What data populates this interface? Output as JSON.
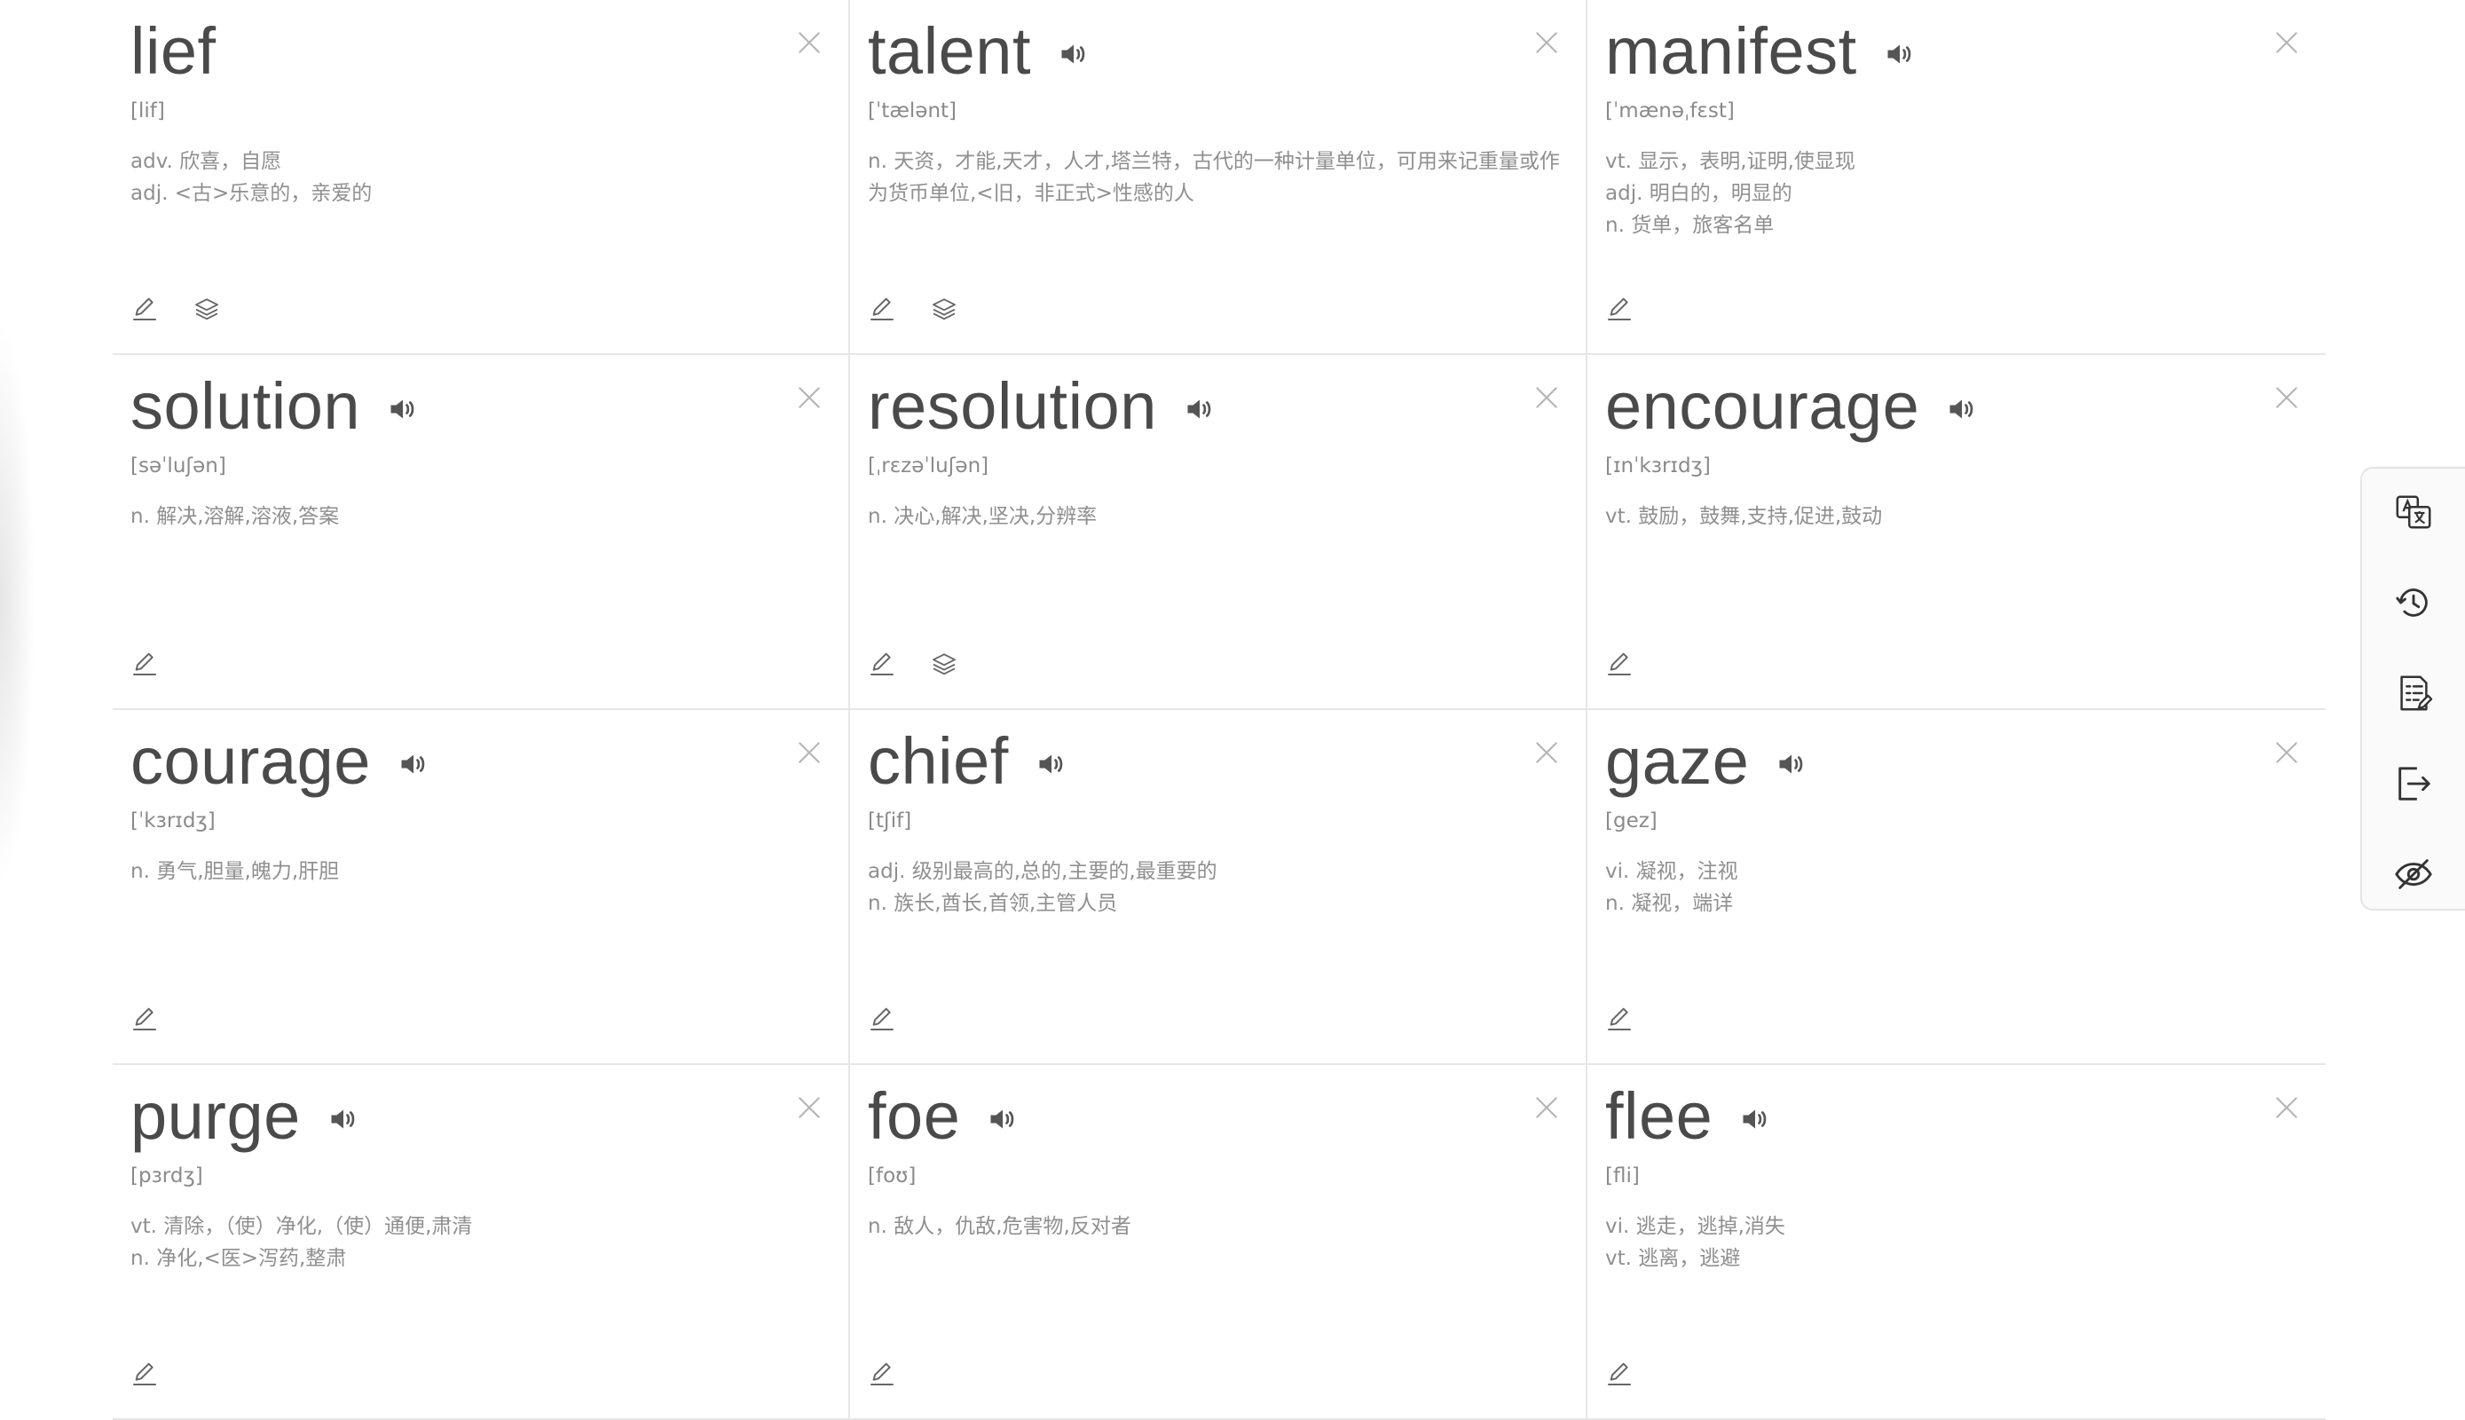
{
  "cards": [
    {
      "word": "lief",
      "speaker": false,
      "phonetic": "[lif]",
      "defs": [
        "adv. 欣喜，自愿",
        "adj. <古>乐意的，亲爱的"
      ],
      "actions": [
        "edit-icon",
        "layers-icon"
      ]
    },
    {
      "word": "talent",
      "speaker": true,
      "phonetic": "[ˈtælənt]",
      "defs": [
        "n. 天资，才能,天才，人才,塔兰特，古代的一种计量单位，可用来记重量或作为货币单位,<旧，非正式>性感的人"
      ],
      "actions": [
        "edit-icon",
        "layers-icon"
      ]
    },
    {
      "word": "manifest",
      "speaker": true,
      "phonetic": "[ˈmænəˌfɛst]",
      "defs": [
        "vt. 显示，表明,证明,使显现",
        "adj. 明白的，明显的",
        "n. 货单，旅客名单"
      ],
      "actions": [
        "edit-icon"
      ]
    },
    {
      "word": "solution",
      "speaker": true,
      "phonetic": "[səˈluʃən]",
      "defs": [
        "n. 解决,溶解,溶液,答案"
      ],
      "actions": [
        "edit-icon"
      ]
    },
    {
      "word": "resolution",
      "speaker": true,
      "phonetic": "[ˌrɛzəˈluʃən]",
      "defs": [
        "n. 决心,解决,坚决,分辨率"
      ],
      "actions": [
        "edit-icon",
        "layers-icon"
      ]
    },
    {
      "word": "encourage",
      "speaker": true,
      "phonetic": "[ɪnˈkɜrɪdʒ]",
      "defs": [
        "vt. 鼓励，鼓舞,支持,促进,鼓动"
      ],
      "actions": [
        "edit-icon"
      ]
    },
    {
      "word": "courage",
      "speaker": true,
      "phonetic": "[ˈkɜrɪdʒ]",
      "defs": [
        "n. 勇气,胆量,魄力,肝胆"
      ],
      "actions": [
        "edit-icon"
      ]
    },
    {
      "word": "chief",
      "speaker": true,
      "phonetic": "[tʃif]",
      "defs": [
        "adj. 级别最高的,总的,主要的,最重要的",
        "n. 族长,酋长,首领,主管人员"
      ],
      "actions": [
        "edit-icon"
      ]
    },
    {
      "word": "gaze",
      "speaker": true,
      "phonetic": "[gez]",
      "defs": [
        "vi. 凝视，注视",
        "n. 凝视，端详"
      ],
      "actions": [
        "edit-icon"
      ]
    },
    {
      "word": "purge",
      "speaker": true,
      "phonetic": "[pɜrdʒ]",
      "defs": [
        "vt. 清除，（使）净化,（使）通便,肃清",
        "n. 净化,<医>泻药,整肃"
      ],
      "actions": [
        "edit-icon"
      ]
    },
    {
      "word": "foe",
      "speaker": true,
      "phonetic": "[foʊ]",
      "defs": [
        "n. 敌人，仇敌,危害物,反对者"
      ],
      "actions": [
        "edit-icon"
      ]
    },
    {
      "word": "flee",
      "speaker": true,
      "phonetic": "[fli]",
      "defs": [
        "vi. 逃走，逃掉,消失",
        "vt. 逃离，逃避"
      ],
      "actions": [
        "edit-icon"
      ]
    }
  ],
  "sidebar": [
    "translate-icon",
    "history-icon",
    "word-list-icon",
    "logout-icon",
    "hide-icon"
  ]
}
